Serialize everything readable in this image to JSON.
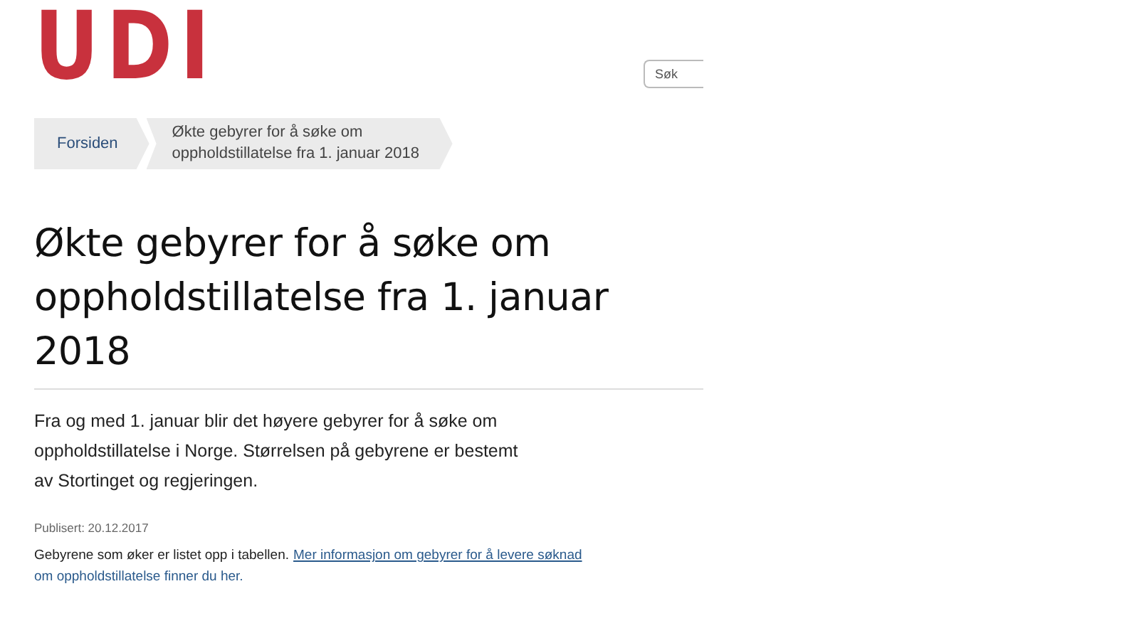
{
  "logo": "UDI",
  "search": {
    "placeholder": "Søk"
  },
  "breadcrumbs": [
    {
      "label": "Forsiden",
      "selected": false
    },
    {
      "label": "Økte gebyrer for å søke om oppholdstillatelse fra 1. januar 2018",
      "selected": true
    }
  ],
  "title": "Økte gebyrer for å søke om oppholdstillatelse fra 1. januar 2018",
  "ingress": "Fra og med 1. januar blir det høyere gebyrer for å søke om oppholdstillatelse i Norge. Størrelsen på gebyrene er bestemt av Stortinget og regjeringen.",
  "published": "Publisert: 20.12.2017",
  "body": {
    "text": "Gebyrene som øker er listet opp i tabellen.",
    "link_lines": [
      "Mer informasjon om gebyrer for å levere søknad",
      "om oppholdstillatelse finner du her."
    ]
  }
}
